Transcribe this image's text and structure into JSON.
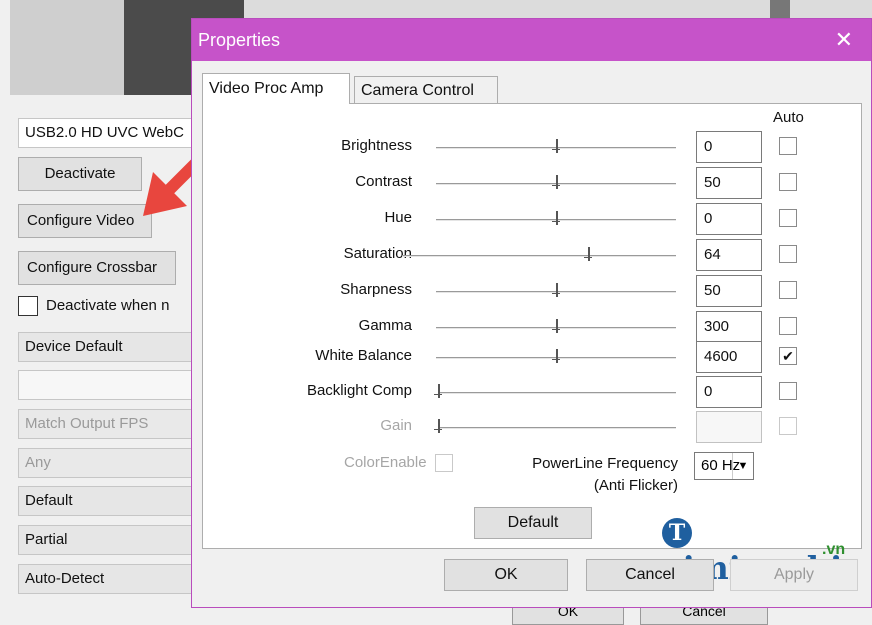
{
  "background_app": {
    "device_field": "USB2.0 HD UVC WebC",
    "deactivate_button": "Deactivate",
    "configure_video_button": "Configure Video",
    "configure_crossbar_button": "Configure Crossbar",
    "deactivate_checkbox_label": "Deactivate when n",
    "fields": [
      "Device Default",
      "",
      "Match Output FPS",
      "Any",
      "Default",
      "Partial",
      "Auto-Detect"
    ],
    "bottom_buttons": [
      "OK",
      "Cancel"
    ]
  },
  "dialog": {
    "title": "Properties",
    "close_glyph": "✕",
    "tabs": [
      "Video Proc Amp",
      "Camera Control"
    ],
    "auto_header": "Auto",
    "controls": [
      {
        "label": "Brightness",
        "value": "0",
        "auto": false,
        "level": 0.5,
        "enabled": true
      },
      {
        "label": "Contrast",
        "value": "50",
        "auto": false,
        "level": 0.5,
        "enabled": true
      },
      {
        "label": "Hue",
        "value": "0",
        "auto": false,
        "level": 0.5,
        "enabled": true
      },
      {
        "label": "Saturation",
        "value": "64",
        "auto": false,
        "level": 0.68,
        "enabled": true
      },
      {
        "label": "Sharpness",
        "value": "50",
        "auto": false,
        "level": 0.5,
        "enabled": true
      },
      {
        "label": "Gamma",
        "value": "300",
        "auto": false,
        "level": 0.5,
        "enabled": true
      },
      {
        "label": "White Balance",
        "value": "4600",
        "auto": true,
        "level": 0.5,
        "enabled": true
      },
      {
        "label": "Backlight Comp",
        "value": "0",
        "auto": false,
        "level": 0.0,
        "enabled": true
      },
      {
        "label": "Gain",
        "value": "",
        "auto": false,
        "level": 0.0,
        "enabled": false
      }
    ],
    "color_enable_label": "ColorEnable",
    "powerline_label_line1": "PowerLine Frequency",
    "powerline_label_line2": "(Anti Flicker)",
    "powerline_value": "60 Hz",
    "default_button": "Default",
    "ok_button": "OK",
    "cancel_button": "Cancel",
    "apply_button": "Apply"
  },
  "watermark": {
    "logo_letter": "T",
    "text": "aimienphi",
    "suffix": ".vn"
  },
  "colors": {
    "titlebar": "#c653c9",
    "arrow": "#e8463e",
    "watermark": "#1f5f9f"
  }
}
